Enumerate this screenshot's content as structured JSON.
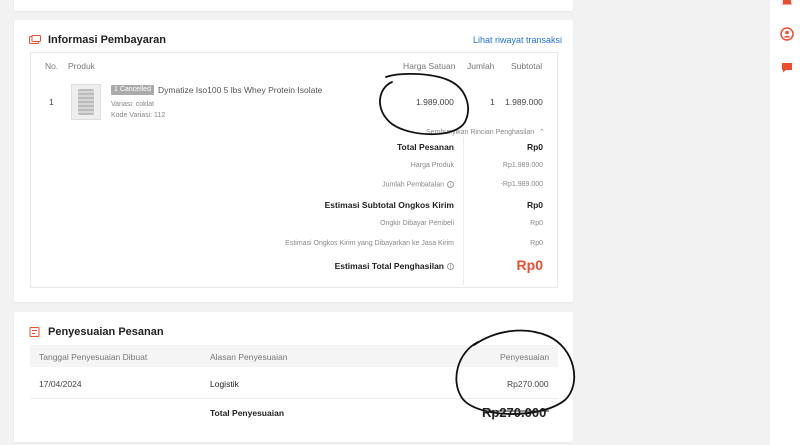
{
  "payment_info": {
    "title": "Informasi Pembayaran",
    "history_link": "Lihat riwayat transaksi",
    "columns": {
      "no": "No.",
      "product": "Produk",
      "unit_price": "Harga Satuan",
      "qty": "Jumlah",
      "subtotal": "Subtotal"
    },
    "item": {
      "no": "1",
      "badge": "1 Cancelled",
      "name": "Dymatize Iso100 5 lbs Whey Protein Isolate",
      "variation": "Variasi: coklat",
      "variation_code": "Kode Variasi: 112",
      "unit_price": "1.989.000",
      "qty": "1",
      "subtotal": "1.989.000"
    },
    "toggle_details": "Sembunyikan Rincian Penghasilan",
    "summary": {
      "total_order_label": "Total Pesanan",
      "total_order_value": "Rp0",
      "product_price_label": "Harga Produk",
      "product_price_value": "Rp1.989.000",
      "cancel_amount_label": "Jumlah Pembatalan",
      "cancel_amount_value": "-Rp1.989.000",
      "shipping_est_label": "Estimasi Subtotal Ongkos Kirim",
      "shipping_est_value": "Rp0",
      "shipping_paid_label": "Ongkir Dibayar Pembeli",
      "shipping_paid_value": "Rp0",
      "shipping_forwarded_label": "Estimasi Ongkos Kirim yang Dibayarkan ke Jasa Kirim",
      "shipping_forwarded_value": "Rp0",
      "income_label": "Estimasi Total Penghasilan",
      "income_value": "Rp0"
    }
  },
  "adjustment": {
    "title": "Penyesuaian Pesanan",
    "columns": {
      "date": "Tanggal Penyesuaian Dibuat",
      "reason": "Alasan Penyesuaian",
      "amount": "Penyesuaian"
    },
    "rows": [
      {
        "date": "17/04/2024",
        "reason": "Logistik",
        "amount": "Rp270.000"
      }
    ],
    "total_label": "Total Penyesuaian",
    "total_value": "Rp270.000"
  },
  "colors": {
    "accent": "#ee4d2d",
    "link": "#2673dd",
    "background": "#f2f2f2"
  },
  "icons": [
    "payment-icon",
    "adjustment-icon",
    "notification-icon",
    "chat-icon",
    "support-icon",
    "chevron-up-icon",
    "info-icon"
  ]
}
